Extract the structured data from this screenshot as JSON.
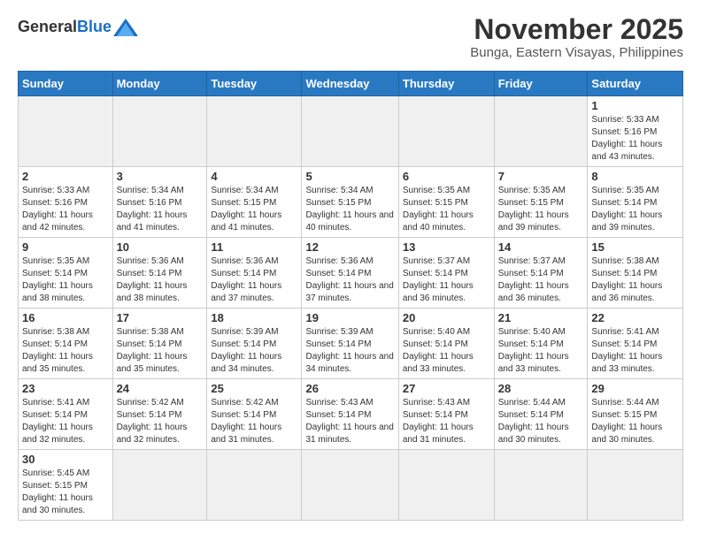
{
  "header": {
    "logo_general": "General",
    "logo_blue": "Blue",
    "month_title": "November 2025",
    "location": "Bunga, Eastern Visayas, Philippines"
  },
  "days_of_week": [
    "Sunday",
    "Monday",
    "Tuesday",
    "Wednesday",
    "Thursday",
    "Friday",
    "Saturday"
  ],
  "weeks": [
    [
      {
        "day": "",
        "info": ""
      },
      {
        "day": "",
        "info": ""
      },
      {
        "day": "",
        "info": ""
      },
      {
        "day": "",
        "info": ""
      },
      {
        "day": "",
        "info": ""
      },
      {
        "day": "",
        "info": ""
      },
      {
        "day": "1",
        "info": "Sunrise: 5:33 AM\nSunset: 5:16 PM\nDaylight: 11 hours and 43 minutes."
      }
    ],
    [
      {
        "day": "2",
        "info": "Sunrise: 5:33 AM\nSunset: 5:16 PM\nDaylight: 11 hours and 42 minutes."
      },
      {
        "day": "3",
        "info": "Sunrise: 5:34 AM\nSunset: 5:16 PM\nDaylight: 11 hours and 41 minutes."
      },
      {
        "day": "4",
        "info": "Sunrise: 5:34 AM\nSunset: 5:15 PM\nDaylight: 11 hours and 41 minutes."
      },
      {
        "day": "5",
        "info": "Sunrise: 5:34 AM\nSunset: 5:15 PM\nDaylight: 11 hours and 40 minutes."
      },
      {
        "day": "6",
        "info": "Sunrise: 5:35 AM\nSunset: 5:15 PM\nDaylight: 11 hours and 40 minutes."
      },
      {
        "day": "7",
        "info": "Sunrise: 5:35 AM\nSunset: 5:15 PM\nDaylight: 11 hours and 39 minutes."
      },
      {
        "day": "8",
        "info": "Sunrise: 5:35 AM\nSunset: 5:14 PM\nDaylight: 11 hours and 39 minutes."
      }
    ],
    [
      {
        "day": "9",
        "info": "Sunrise: 5:35 AM\nSunset: 5:14 PM\nDaylight: 11 hours and 38 minutes."
      },
      {
        "day": "10",
        "info": "Sunrise: 5:36 AM\nSunset: 5:14 PM\nDaylight: 11 hours and 38 minutes."
      },
      {
        "day": "11",
        "info": "Sunrise: 5:36 AM\nSunset: 5:14 PM\nDaylight: 11 hours and 37 minutes."
      },
      {
        "day": "12",
        "info": "Sunrise: 5:36 AM\nSunset: 5:14 PM\nDaylight: 11 hours and 37 minutes."
      },
      {
        "day": "13",
        "info": "Sunrise: 5:37 AM\nSunset: 5:14 PM\nDaylight: 11 hours and 36 minutes."
      },
      {
        "day": "14",
        "info": "Sunrise: 5:37 AM\nSunset: 5:14 PM\nDaylight: 11 hours and 36 minutes."
      },
      {
        "day": "15",
        "info": "Sunrise: 5:38 AM\nSunset: 5:14 PM\nDaylight: 11 hours and 36 minutes."
      }
    ],
    [
      {
        "day": "16",
        "info": "Sunrise: 5:38 AM\nSunset: 5:14 PM\nDaylight: 11 hours and 35 minutes."
      },
      {
        "day": "17",
        "info": "Sunrise: 5:38 AM\nSunset: 5:14 PM\nDaylight: 11 hours and 35 minutes."
      },
      {
        "day": "18",
        "info": "Sunrise: 5:39 AM\nSunset: 5:14 PM\nDaylight: 11 hours and 34 minutes."
      },
      {
        "day": "19",
        "info": "Sunrise: 5:39 AM\nSunset: 5:14 PM\nDaylight: 11 hours and 34 minutes."
      },
      {
        "day": "20",
        "info": "Sunrise: 5:40 AM\nSunset: 5:14 PM\nDaylight: 11 hours and 33 minutes."
      },
      {
        "day": "21",
        "info": "Sunrise: 5:40 AM\nSunset: 5:14 PM\nDaylight: 11 hours and 33 minutes."
      },
      {
        "day": "22",
        "info": "Sunrise: 5:41 AM\nSunset: 5:14 PM\nDaylight: 11 hours and 33 minutes."
      }
    ],
    [
      {
        "day": "23",
        "info": "Sunrise: 5:41 AM\nSunset: 5:14 PM\nDaylight: 11 hours and 32 minutes."
      },
      {
        "day": "24",
        "info": "Sunrise: 5:42 AM\nSunset: 5:14 PM\nDaylight: 11 hours and 32 minutes."
      },
      {
        "day": "25",
        "info": "Sunrise: 5:42 AM\nSunset: 5:14 PM\nDaylight: 11 hours and 31 minutes."
      },
      {
        "day": "26",
        "info": "Sunrise: 5:43 AM\nSunset: 5:14 PM\nDaylight: 11 hours and 31 minutes."
      },
      {
        "day": "27",
        "info": "Sunrise: 5:43 AM\nSunset: 5:14 PM\nDaylight: 11 hours and 31 minutes."
      },
      {
        "day": "28",
        "info": "Sunrise: 5:44 AM\nSunset: 5:14 PM\nDaylight: 11 hours and 30 minutes."
      },
      {
        "day": "29",
        "info": "Sunrise: 5:44 AM\nSunset: 5:15 PM\nDaylight: 11 hours and 30 minutes."
      }
    ],
    [
      {
        "day": "30",
        "info": "Sunrise: 5:45 AM\nSunset: 5:15 PM\nDaylight: 11 hours and 30 minutes."
      },
      {
        "day": "",
        "info": ""
      },
      {
        "day": "",
        "info": ""
      },
      {
        "day": "",
        "info": ""
      },
      {
        "day": "",
        "info": ""
      },
      {
        "day": "",
        "info": ""
      },
      {
        "day": "",
        "info": ""
      }
    ]
  ]
}
